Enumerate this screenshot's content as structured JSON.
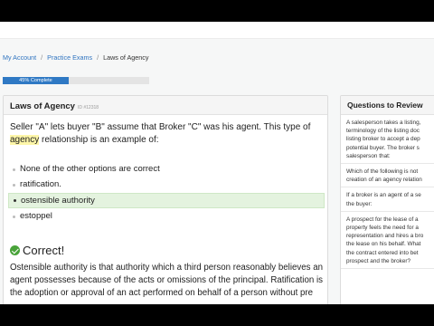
{
  "breadcrumb": {
    "items": [
      "My Account",
      "Practice Exams",
      "Laws of Agency"
    ]
  },
  "progress": {
    "percent": 45,
    "label": "45% Complete"
  },
  "question_card": {
    "title": "Laws of Agency",
    "id": "ID #12318",
    "question_before": "Seller \"A\" lets buyer \"B\" assume that Broker \"C\" was his agent. This type of",
    "question_highlight": "agency",
    "question_after": " relationship is an example of:",
    "options": [
      "None of the other options are correct",
      "ratification.",
      "ostensible authority",
      "estoppel"
    ],
    "selected_index": 2,
    "result": "Correct!",
    "explanation": "Ostensible authority is that authority which a third person reasonably believes an agent possesses because of the acts or omissions of the principal. Ratification is the adoption or approval of an act performed on behalf of a person without pre"
  },
  "review_panel": {
    "title": "Questions to Review",
    "items": [
      "A salesperson takes a listing,\nterminology of the listing doc\nlisting broker to accept a dep\npotential buyer. The broker s\nsalesperson that:",
      "Which of the following is not\ncreation of an agency relation",
      "If a broker is an agent of a se\nthe buyer:",
      "A prospect for the lease of a\nproperty feels the need for a\nrepresentation and hires a bro\nthe lease on his behalf. What\nthe contract entered into bet\nprospect and the broker?"
    ]
  },
  "colors": {
    "link": "#2f74c0",
    "progress": "#2f79c4",
    "correct": "#49a33a",
    "selected_bg": "#e4f3df",
    "highlight": "#fdf6a8"
  }
}
